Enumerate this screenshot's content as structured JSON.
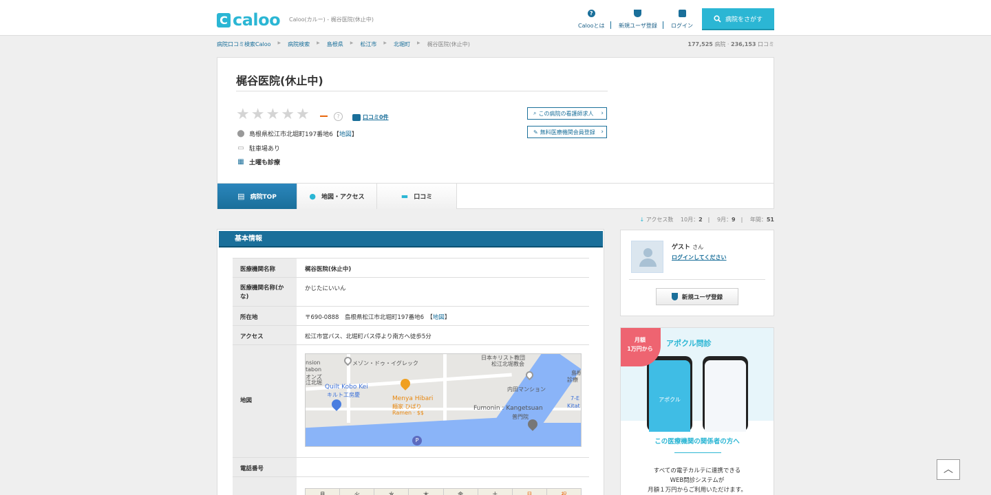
{
  "header": {
    "logo_mark": "C",
    "logo_text": "caloo",
    "tagline": "Caloo(カルー) - 梶谷医院(休止中)",
    "nav": [
      {
        "label": "Calooとは",
        "icon": "question-icon"
      },
      {
        "label": "新規ユーザ登録",
        "icon": "beginner-leaf-icon"
      },
      {
        "label": "ログイン",
        "icon": "lock-icon"
      }
    ],
    "search_button": "病院をさがす",
    "accent": "#2bb6d4",
    "brand": "#1a6f9a"
  },
  "breadcrumb": [
    "病院口コミ検索Caloo",
    "病院検索",
    "島根県",
    "松江市",
    "北堀町",
    "梶谷医院(休止中)"
  ],
  "stats": {
    "hospitals": "177,525",
    "hospitals_label": "病院",
    "reviews": "236,153",
    "reviews_label": "口コミ"
  },
  "hospital": {
    "name": "梶谷医院(休止中)",
    "rating_stars": 0,
    "rating_text": "—",
    "review_link": "口コミ0件",
    "address": "島根県松江市北堀町197番地6【",
    "map_link": "地図",
    "address_close": "】",
    "parking": "駐車場あり",
    "saturday": "土曜も診療",
    "side_links": [
      "この病院の看護師求人",
      "無料医療機関会員登録"
    ]
  },
  "tabs": [
    {
      "label": "病院TOP",
      "icon": "hospital-icon",
      "active": true
    },
    {
      "label": "地図・アクセス",
      "icon": "map-pin-icon",
      "active": false
    },
    {
      "label": "口コミ",
      "icon": "speech-bubble-icon",
      "active": false
    }
  ],
  "access": {
    "label": "アクセス数",
    "oct_label": "10月：",
    "oct": "2",
    "sep_label": "9月：",
    "sep": "9",
    "year_label": "年間：",
    "year": "51"
  },
  "basic_info": {
    "heading": "基本情報",
    "rows": [
      {
        "key": "医療機関名称",
        "value": "梶谷医院(休止中)"
      },
      {
        "key": "医療機関名称(かな)",
        "value": "かじたにいいん"
      },
      {
        "key": "所在地",
        "value": "〒690-0888　島根県松江市北堀町197番地6　【",
        "link": "地図",
        "tail": "】"
      },
      {
        "key": "アクセス",
        "value": "松江市営バス、北堀町バス停より南方へ徒歩5分"
      },
      {
        "key": "地図",
        "value": ""
      },
      {
        "key": "電話番号",
        "value": ""
      }
    ],
    "map_labels": {
      "a": "メゾン・ドゥ・イグレック",
      "b": "日本キリスト教団",
      "c": "松江北堀教会",
      "d": "Quilt Kobo Kei",
      "e": "キルト工房慶",
      "f": "Menya Hibari",
      "g": "麺家 ひばり",
      "h": "Ramen · $$",
      "i": "内田マンション",
      "j": "Fumonin : Kangetsuan",
      "k": "普門院",
      "l": "7-E",
      "m": "Kitat",
      "n": "島根",
      "o": "診療",
      "p": "nsion",
      "q": "tabon",
      "r": "オンズ",
      "s": "江北堀",
      "parking": "P"
    },
    "calendar_days": [
      "月",
      "火",
      "水",
      "木",
      "金",
      "土",
      "日",
      "祝"
    ]
  },
  "login_box": {
    "guest": "ゲスト",
    "honorific": "さん",
    "login_link": "ログインしてください",
    "register_button": "新規ユーザ登録"
  },
  "ad": {
    "badge_line1": "月額",
    "badge_line2": "1万円から",
    "brand": "アポクル問診",
    "phone_label": "アポクル",
    "subtitle": "この医療機関の関係者の方へ",
    "body": [
      "すべての電子カルテに連携できる",
      "WEB問診システムが",
      "月額１万円からご利用いただけます。"
    ]
  },
  "to_top": "︿"
}
